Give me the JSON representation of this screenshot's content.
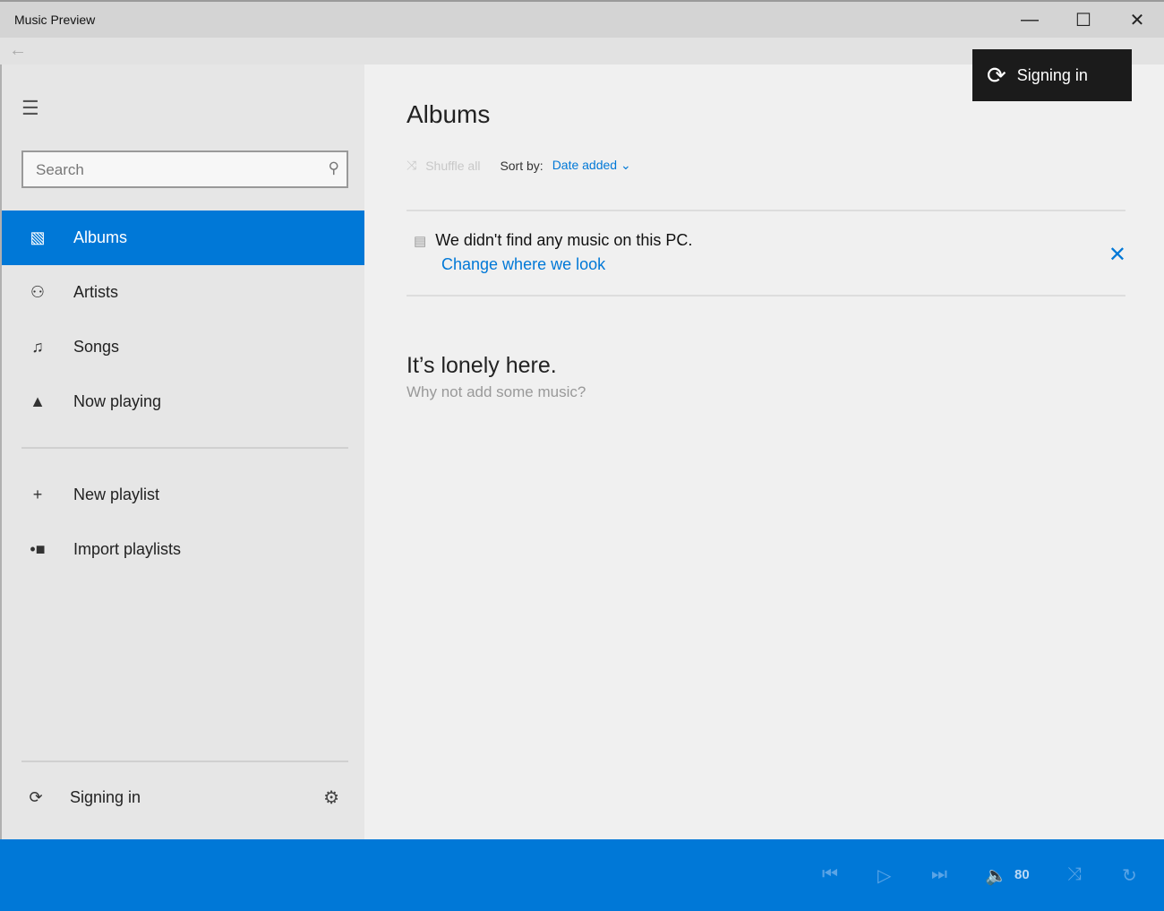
{
  "window": {
    "title": "Music Preview",
    "minimize": "—",
    "maximize": "☐",
    "close": "✕"
  },
  "back": "←",
  "sidebar": {
    "search_placeholder": "Search",
    "items": [
      {
        "label": "Albums",
        "icon": "▧"
      },
      {
        "label": "Artists",
        "icon": "⚇"
      },
      {
        "label": "Songs",
        "icon": "♫"
      },
      {
        "label": "Now playing",
        "icon": "▲"
      }
    ],
    "playlist_items": [
      {
        "label": "New playlist",
        "icon": "+"
      },
      {
        "label": "Import playlists",
        "icon": "•■"
      }
    ],
    "account": {
      "label": "Signing in",
      "icon": "⟳",
      "settings_icon": "⚙"
    }
  },
  "main": {
    "title": "Albums",
    "shuffle_label": "Shuffle all",
    "sort_label": "Sort by:",
    "sort_value": "Date added",
    "notice": "We didn't find any music on this PC.",
    "notice_link": "Change where we look",
    "empty_title": "It’s lonely here.",
    "empty_subtitle": "Why not add some music?"
  },
  "signing_banner": {
    "label": "Signing in"
  },
  "player": {
    "volume": "80"
  }
}
